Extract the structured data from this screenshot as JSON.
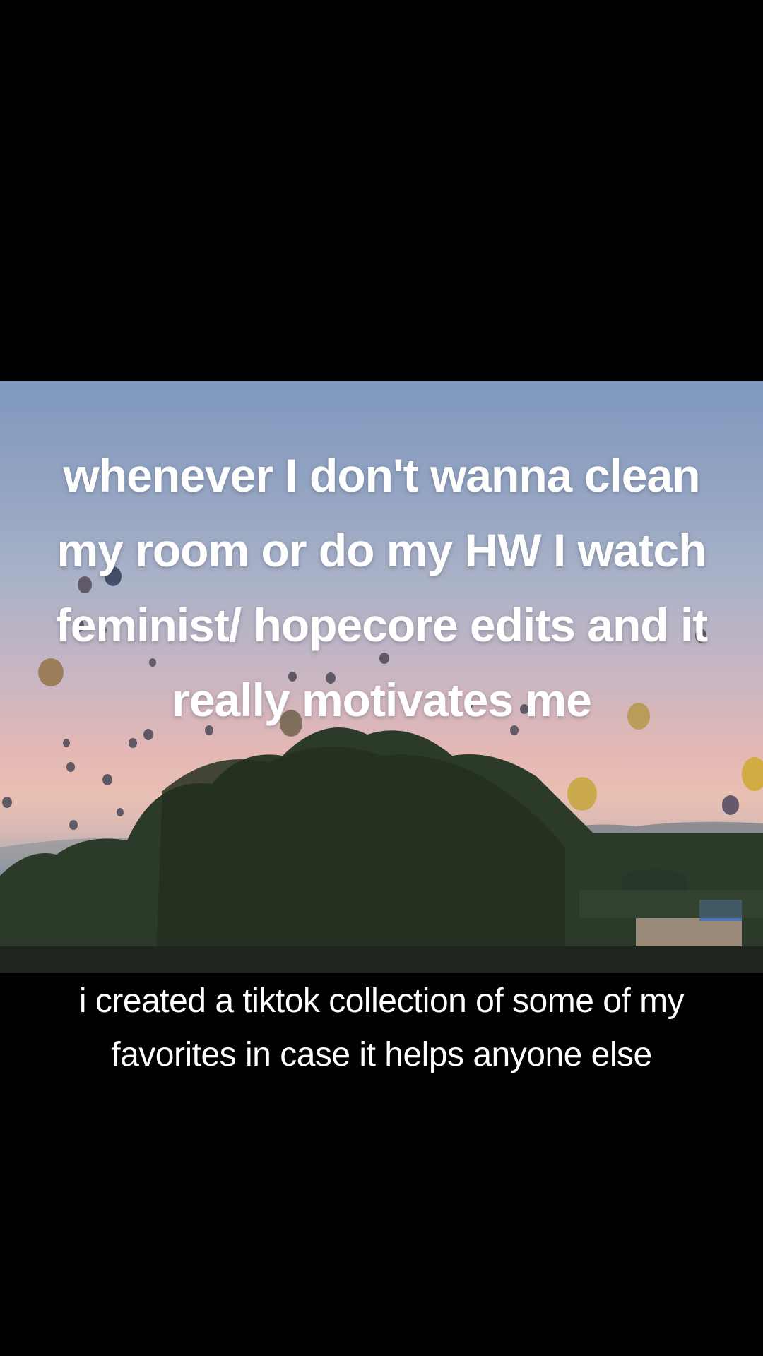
{
  "video": {
    "overlay_text": "whenever I don't wanna clean my room or do my HW I watch feminist/ hopecore edits and it really motivates me",
    "scene": "hot-air-balloon-sunset-icon"
  },
  "caption": {
    "text": "i created a tiktok collection of some of my favorites in case it helps anyone else"
  },
  "colors": {
    "background": "#000000",
    "text": "#ffffff",
    "sky_top": "#7f98be",
    "sky_horizon": "#e9c0b3",
    "foliage": "#2c3a2a"
  }
}
